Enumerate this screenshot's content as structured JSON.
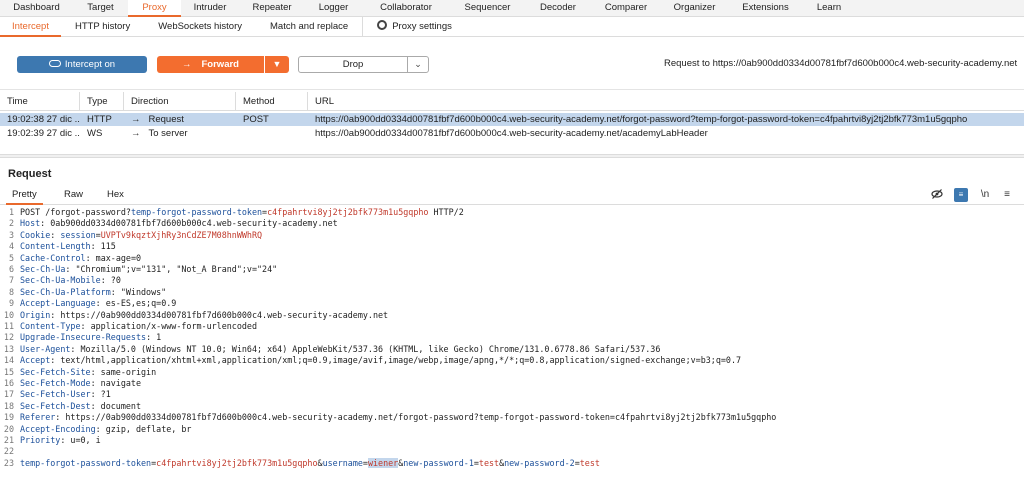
{
  "main_tabs": [
    "Dashboard",
    "Target",
    "Proxy",
    "Intruder",
    "Repeater",
    "Logger",
    "Collaborator",
    "Sequencer",
    "Decoder",
    "Comparer",
    "Organizer",
    "Extensions",
    "Learn"
  ],
  "sub_tabs": [
    "Intercept",
    "HTTP history",
    "WebSockets history",
    "Match and replace"
  ],
  "proxy_settings_label": "Proxy settings",
  "toolbar": {
    "intercept_label": "Intercept on",
    "forward_label": "Forward",
    "drop_label": "Drop",
    "request_to": "Request to https://0ab900dd0334d00781fbf7d600b000c4.web-security-academy.net"
  },
  "table": {
    "headers": [
      "Time",
      "Type",
      "Direction",
      "Method",
      "URL"
    ],
    "rows": [
      {
        "time": "19:02:38 27 dic ...",
        "type": "HTTP",
        "direction": "Request",
        "method": "POST",
        "url": "https://0ab900dd0334d00781fbf7d600b000c4.web-security-academy.net/forgot-password?temp-forgot-password-token=c4fpahrtvi8yj2tj2bfk773m1u5gqpho"
      },
      {
        "time": "19:02:39 27 dic ...",
        "type": "WS",
        "direction": "To server",
        "method": "",
        "url": "https://0ab900dd0334d00781fbf7d600b000c4.web-security-academy.net/academyLabHeader"
      }
    ]
  },
  "request_panel": {
    "title": "Request",
    "tabs": [
      "Pretty",
      "Raw",
      "Hex"
    ],
    "wrap_label": "\\n",
    "lines": [
      {
        "n": "1",
        "parts": [
          {
            "t": "POST /forgot-password?",
            "c": ""
          },
          {
            "t": "temp-forgot-password-token",
            "c": "k"
          },
          {
            "t": "=",
            "c": ""
          },
          {
            "t": "c4fpahrtvi8yj2tj2bfk773m1u5gqpho",
            "c": "r"
          },
          {
            "t": " HTTP/2",
            "c": ""
          }
        ]
      },
      {
        "n": "2",
        "parts": [
          {
            "t": "Host",
            "c": "k"
          },
          {
            "t": ": 0ab900dd0334d00781fbf7d600b000c4.web-security-academy.net",
            "c": ""
          }
        ]
      },
      {
        "n": "3",
        "parts": [
          {
            "t": "Cookie",
            "c": "k"
          },
          {
            "t": ": ",
            "c": ""
          },
          {
            "t": "session",
            "c": "k"
          },
          {
            "t": "=",
            "c": ""
          },
          {
            "t": "UVPTv9kqztXjhRy3nCdZE7M08hnWWhRQ",
            "c": "r"
          }
        ]
      },
      {
        "n": "4",
        "parts": [
          {
            "t": "Content-Length",
            "c": "k"
          },
          {
            "t": ": 115",
            "c": ""
          }
        ]
      },
      {
        "n": "5",
        "parts": [
          {
            "t": "Cache-Control",
            "c": "k"
          },
          {
            "t": ": max-age=0",
            "c": ""
          }
        ]
      },
      {
        "n": "6",
        "parts": [
          {
            "t": "Sec-Ch-Ua",
            "c": "k"
          },
          {
            "t": ": \"Chromium\";v=\"131\", \"Not_A Brand\";v=\"24\"",
            "c": ""
          }
        ]
      },
      {
        "n": "7",
        "parts": [
          {
            "t": "Sec-Ch-Ua-Mobile",
            "c": "k"
          },
          {
            "t": ": ?0",
            "c": ""
          }
        ]
      },
      {
        "n": "8",
        "parts": [
          {
            "t": "Sec-Ch-Ua-Platform",
            "c": "k"
          },
          {
            "t": ": \"Windows\"",
            "c": ""
          }
        ]
      },
      {
        "n": "9",
        "parts": [
          {
            "t": "Accept-Language",
            "c": "k"
          },
          {
            "t": ": es-ES,es;q=0.9",
            "c": ""
          }
        ]
      },
      {
        "n": "10",
        "parts": [
          {
            "t": "Origin",
            "c": "k"
          },
          {
            "t": ": https://0ab900dd0334d00781fbf7d600b000c4.web-security-academy.net",
            "c": ""
          }
        ]
      },
      {
        "n": "11",
        "parts": [
          {
            "t": "Content-Type",
            "c": "k"
          },
          {
            "t": ": application/x-www-form-urlencoded",
            "c": ""
          }
        ]
      },
      {
        "n": "12",
        "parts": [
          {
            "t": "Upgrade-Insecure-Requests",
            "c": "k"
          },
          {
            "t": ": 1",
            "c": ""
          }
        ]
      },
      {
        "n": "13",
        "parts": [
          {
            "t": "User-Agent",
            "c": "k"
          },
          {
            "t": ": Mozilla/5.0 (Windows NT 10.0; Win64; x64) AppleWebKit/537.36 (KHTML, like Gecko) Chrome/131.0.6778.86 Safari/537.36",
            "c": ""
          }
        ]
      },
      {
        "n": "14",
        "parts": [
          {
            "t": "Accept",
            "c": "k"
          },
          {
            "t": ": text/html,application/xhtml+xml,application/xml;q=0.9,image/avif,image/webp,image/apng,*/*;q=0.8,application/signed-exchange;v=b3;q=0.7",
            "c": ""
          }
        ]
      },
      {
        "n": "15",
        "parts": [
          {
            "t": "Sec-Fetch-Site",
            "c": "k"
          },
          {
            "t": ": same-origin",
            "c": ""
          }
        ]
      },
      {
        "n": "16",
        "parts": [
          {
            "t": "Sec-Fetch-Mode",
            "c": "k"
          },
          {
            "t": ": navigate",
            "c": ""
          }
        ]
      },
      {
        "n": "17",
        "parts": [
          {
            "t": "Sec-Fetch-User",
            "c": "k"
          },
          {
            "t": ": ?1",
            "c": ""
          }
        ]
      },
      {
        "n": "18",
        "parts": [
          {
            "t": "Sec-Fetch-Dest",
            "c": "k"
          },
          {
            "t": ": document",
            "c": ""
          }
        ]
      },
      {
        "n": "19",
        "parts": [
          {
            "t": "Referer",
            "c": "k"
          },
          {
            "t": ": https://0ab900dd0334d00781fbf7d600b000c4.web-security-academy.net/forgot-password?temp-forgot-password-token=c4fpahrtvi8yj2tj2bfk773m1u5gqpho",
            "c": ""
          }
        ]
      },
      {
        "n": "20",
        "parts": [
          {
            "t": "Accept-Encoding",
            "c": "k"
          },
          {
            "t": ": gzip, deflate, br",
            "c": ""
          }
        ]
      },
      {
        "n": "21",
        "parts": [
          {
            "t": "Priority",
            "c": "k"
          },
          {
            "t": ": u=0, i",
            "c": ""
          }
        ]
      },
      {
        "n": "22",
        "parts": []
      },
      {
        "n": "23",
        "parts": [
          {
            "t": "temp-forgot-password-token",
            "c": "k"
          },
          {
            "t": "=",
            "c": ""
          },
          {
            "t": "c4fpahrtvi8yj2tj2bfk773m1u5gqpho",
            "c": "r"
          },
          {
            "t": "&",
            "c": ""
          },
          {
            "t": "username",
            "c": "k"
          },
          {
            "t": "=",
            "c": ""
          },
          {
            "t": "wiener",
            "c": "r sel"
          },
          {
            "t": "&",
            "c": ""
          },
          {
            "t": "new-password-1",
            "c": "k"
          },
          {
            "t": "=",
            "c": ""
          },
          {
            "t": "test",
            "c": "r"
          },
          {
            "t": "&",
            "c": ""
          },
          {
            "t": "new-password-2",
            "c": "k"
          },
          {
            "t": "=",
            "c": ""
          },
          {
            "t": "test",
            "c": "r"
          }
        ]
      }
    ]
  },
  "colors": {
    "accent": "#e9692c",
    "forward_button": "#f36d2f",
    "intercept_button": "#3d78b0",
    "selected_row": "#c3d6ec",
    "keyword": "#1b4f9a",
    "value": "#c0392b"
  },
  "icons": [
    "gear-icon",
    "toggle-icon",
    "arrow-right-icon",
    "chevron-down-icon",
    "eye-off-icon",
    "wrap-icon",
    "menu-icon"
  ]
}
